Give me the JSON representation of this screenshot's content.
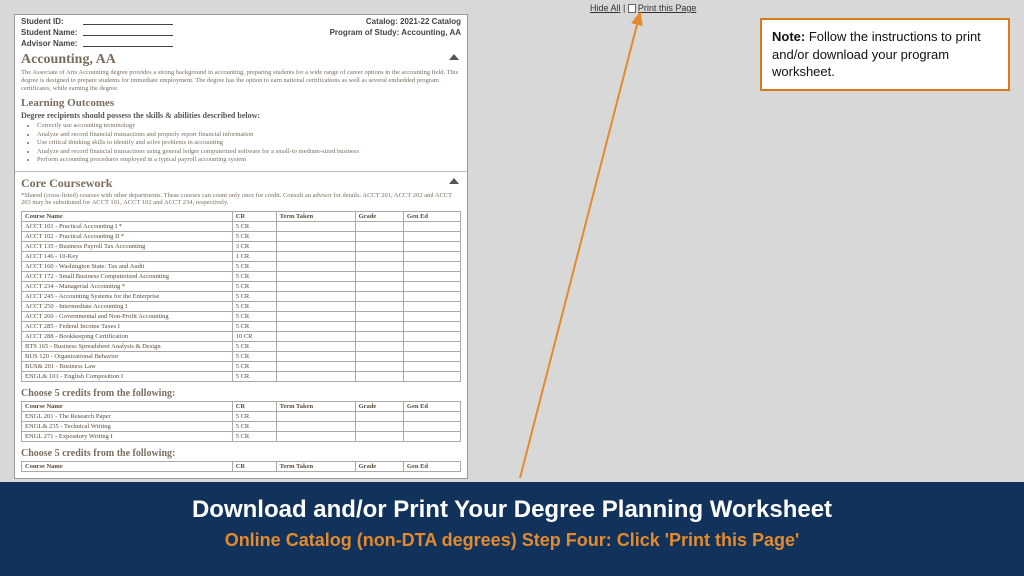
{
  "topLinks": {
    "hideAll": "Hide All",
    "sep": " | ",
    "printThisPage": "Print this Page"
  },
  "noteBox": {
    "label": "Note:",
    "text": " Follow the instructions to print and/or download your program worksheet."
  },
  "worksheet": {
    "studentIdLabel": "Student ID:",
    "studentNameLabel": "Student Name:",
    "advisorNameLabel": "Advisor Name:",
    "catalogLabel": "Catalog: 2021-22 Catalog",
    "programLabel": "Program of Study: Accounting, AA",
    "title": "Accounting, AA",
    "intro": "The Associate of Arts Accounting degree provides a strong background in accounting, preparing students for a wide range of career options in the accounting field. This degree is designed to prepare students for immediate employment. The degree has the option to earn national certifications as well as several embedded program certificates, while earning the degree.",
    "outcomesTitle": "Learning Outcomes",
    "outcomesSub": "Degree recipients should possess the skills & abilities described below:",
    "outcomes": [
      "Correctly use accounting terminology",
      "Analyze and record financial transactions and properly report financial information",
      "Use critical thinking skills to identify and solve problems in accounting",
      "Analyze and record financial transactions using general ledger computerized software for a small-to medium-sized business",
      "Perform accounting procedures employed in a typical payroll accounting system"
    ],
    "coreTitle": "Core Coursework",
    "coreNote": "*Shared (cross-listed) courses with other departments. These courses can count only once for credit. Consult an advisor for details. ACCT 201, ACCT 202 and ACCT 203 may be substituted for ACCT 101, ACCT 102 and ACCT 234, respectively.",
    "headers": {
      "courseName": "Course Name",
      "cr": "CR",
      "termTaken": "Term Taken",
      "grade": "Grade",
      "genEd": "Gen Ed"
    },
    "coreCourses": [
      {
        "name": "ACCT 101 - Practical Accounting I *",
        "cr": "5 CR"
      },
      {
        "name": "ACCT 102 - Practical Accounting II *",
        "cr": "5 CR"
      },
      {
        "name": "ACCT 135 - Business Payroll Tax Accounting",
        "cr": "3 CR"
      },
      {
        "name": "ACCT 146 - 10-Key",
        "cr": "1 CR"
      },
      {
        "name": "ACCT 160 - Washington State: Tax and Audit",
        "cr": "5 CR"
      },
      {
        "name": "ACCT 172 - Small Business Computerized Accounting",
        "cr": "5 CR"
      },
      {
        "name": "ACCT 234 - Managerial Accounting *",
        "cr": "5 CR"
      },
      {
        "name": "ACCT 245 - Accounting Systems for the Enterprise",
        "cr": "5 CR"
      },
      {
        "name": "ACCT 250 - Intermediate Accounting I",
        "cr": "5 CR"
      },
      {
        "name": "ACCT 260 - Governmental and Non-Profit Accounting",
        "cr": "5 CR"
      },
      {
        "name": "ACCT 285 - Federal Income Taxes I",
        "cr": "5 CR"
      },
      {
        "name": "ACCT 288 - Bookkeeping Certification",
        "cr": "10 CR"
      },
      {
        "name": "BTS 165 - Business Spreadsheet Analysis & Design",
        "cr": "5 CR"
      },
      {
        "name": "BUS 120 - Organizational Behavior",
        "cr": "5 CR"
      },
      {
        "name": "BUS& 201 - Business Law",
        "cr": "5 CR"
      },
      {
        "name": "ENGL& 101 - English Composition I",
        "cr": "5 CR"
      }
    ],
    "elective1Title": "Choose 5 credits from the following:",
    "elective1Courses": [
      {
        "name": "ENGL 201 - The Research Paper",
        "cr": "5 CR"
      },
      {
        "name": "ENGL& 235 - Technical Writing",
        "cr": "5 CR"
      },
      {
        "name": "ENGL 271 - Expository Writing I",
        "cr": "5 CR"
      }
    ],
    "elective2Title": "Choose 5 credits from the following:"
  },
  "banner": {
    "line1": "Download and/or Print Your Degree Planning Worksheet",
    "line2": "Online Catalog (non-DTA degrees) Step Four: Click 'Print this Page'"
  }
}
